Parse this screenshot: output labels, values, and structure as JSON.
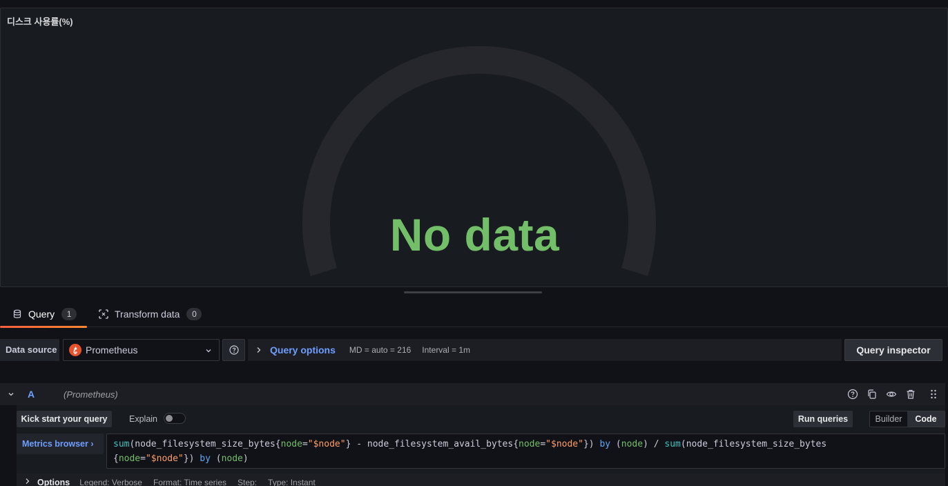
{
  "panel": {
    "title": "디스크 사용률(%)",
    "status": "No data",
    "gauge_color": "#73bf69",
    "gauge_track_color": "#25272c"
  },
  "tabs": [
    {
      "label": "Query",
      "count": "1",
      "icon": "database-icon",
      "active": true
    },
    {
      "label": "Transform data",
      "count": "0",
      "icon": "transform-icon",
      "active": false
    }
  ],
  "datasource": {
    "label": "Data source",
    "selected": "Prometheus",
    "icon": "prometheus-logo"
  },
  "query_options": {
    "title": "Query options",
    "md": "MD = auto = 216",
    "interval": "Interval = 1m"
  },
  "inspector_label": "Query inspector",
  "query_row": {
    "ref_id": "A",
    "datasource_name": "(Prometheus)"
  },
  "editor": {
    "kick_start": "Kick start your query",
    "explain": "Explain",
    "run_queries": "Run queries",
    "modes": [
      "Builder",
      "Code"
    ],
    "active_mode": "Code",
    "metrics_browser": "Metrics browser ›",
    "query": "sum(node_filesystem_size_bytes{node=\"$node\"} - node_filesystem_avail_bytes{node=\"$node\"}) by (node) / sum(node_filesystem_size_bytes {node=\"$node\"}) by (node)"
  },
  "options": {
    "title": "Options",
    "legend": "Legend: Verbose",
    "format": "Format: Time series",
    "step": "Step:",
    "type": "Type: Instant"
  },
  "colors": {
    "accent_blue": "#6e9fff",
    "tab_underline": "#ff6a3d",
    "nodata_green": "#73bf69"
  }
}
